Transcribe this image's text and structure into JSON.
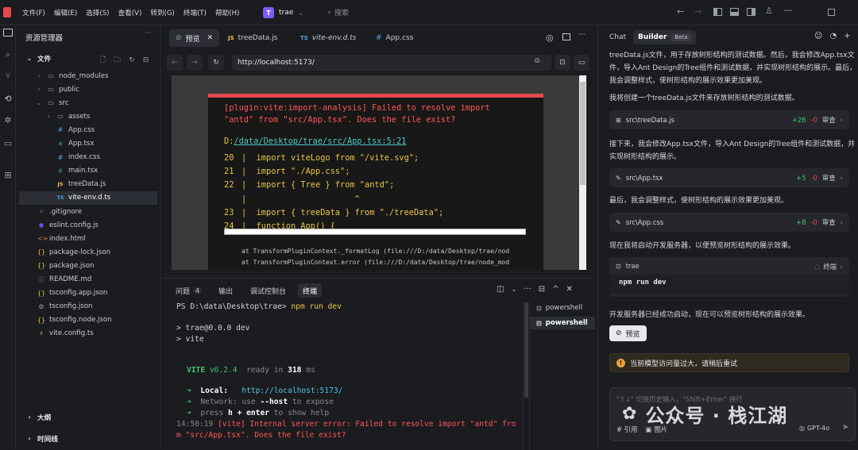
{
  "titlebar": {
    "menus": [
      "文件(F)",
      "编辑(E)",
      "选择(S)",
      "查看(V)",
      "转到(G)",
      "终端(T)",
      "帮助(H)"
    ],
    "project_initial": "T",
    "project_name": "trae",
    "search_placeholder": "搜索"
  },
  "explorer": {
    "title": "资源管理器",
    "files_header": "文件",
    "items": [
      {
        "label": "node_modules",
        "icon": "folder-icon"
      },
      {
        "label": "public",
        "icon": "folder-icon"
      },
      {
        "label": "src",
        "icon": "folder-open-icon"
      },
      {
        "label": "assets",
        "icon": "folder-icon"
      },
      {
        "label": "App.css",
        "icon": "css-icon"
      },
      {
        "label": "App.tsx",
        "icon": "react-icon"
      },
      {
        "label": "index.css",
        "icon": "css-icon"
      },
      {
        "label": "main.tsx",
        "icon": "react-icon"
      },
      {
        "label": "treeData.js",
        "icon": "js-icon"
      },
      {
        "label": "vite-env.d.ts",
        "icon": "ts-icon"
      },
      {
        "label": ".gitignore",
        "icon": "git-icon"
      },
      {
        "label": "eslint.config.js",
        "icon": "eslint-icon"
      },
      {
        "label": "index.html",
        "icon": "html-icon"
      },
      {
        "label": "package-lock.json",
        "icon": "json-icon"
      },
      {
        "label": "package.json",
        "icon": "json-icon"
      },
      {
        "label": "README.md",
        "icon": "info-icon"
      },
      {
        "label": "tsconfig.app.json",
        "icon": "json-icon"
      },
      {
        "label": "tsconfig.json",
        "icon": "gear-icon"
      },
      {
        "label": "tsconfig.node.json",
        "icon": "json-icon"
      },
      {
        "label": "vite.config.ts",
        "icon": "vite-icon"
      }
    ],
    "outline": "大纲",
    "timeline": "时间线"
  },
  "editor": {
    "tabs": [
      {
        "label": "预览",
        "icon": "compass-icon"
      },
      {
        "label": "treeData.js",
        "icon": "js-icon"
      },
      {
        "label": "vite-env.d.ts",
        "icon": "ts-icon"
      },
      {
        "label": "App.css",
        "icon": "css-icon"
      }
    ],
    "url": "http://localhost:5173/"
  },
  "error_overlay": {
    "message_line1": "[plugin:vite:import-analysis] Failed to resolve import",
    "message_line2": "\"antd\" from \"src/App.tsx\". Does the file exist?",
    "file_prefix": "D:",
    "file_path": "/data/Desktop/trae/src/App.tsx:5:21",
    "code": [
      {
        "no": "20",
        "code": "import viteLogo from \"/vite.svg\";"
      },
      {
        "no": "21",
        "code": "import \"./App.css\";"
      },
      {
        "no": "22",
        "code": "import { Tree } from \"antd\";"
      },
      {
        "no": "",
        "code": "                    ^"
      },
      {
        "no": "23",
        "code": "import { treeData } from \"./treeData\";"
      },
      {
        "no": "24",
        "code": "function App() {"
      }
    ],
    "stack1": "at TransformPluginContext._formatLog (file:///D:/data/Desktop/trae/nod",
    "stack2": "at TransformPluginContext.error (file:///D:/data/Desktop/trae/node_mod"
  },
  "terminal": {
    "tabs": [
      {
        "label": "问题",
        "badge": "4"
      },
      {
        "label": "输出"
      },
      {
        "label": "调试控制台"
      },
      {
        "label": "终端"
      }
    ],
    "ps_prompt": "PS D:\\data\\Desktop\\trae>",
    "ps_cmd": "npm run dev",
    "line_dev": "> trae@0.0.0 dev",
    "line_vite": "> vite",
    "vite_name": "VITE",
    "vite_version": "v6.2.4",
    "ready_text": "ready in",
    "ready_ms": "318",
    "ready_unit": "ms",
    "local_label": "Local:",
    "local_url": "http://localhost:5173/",
    "network_label": "Network:",
    "network_text": "use",
    "network_flag": "--host",
    "network_tail": "to expose",
    "help_pre": "press",
    "help_key": "h + enter",
    "help_post": "to show help",
    "err_time": "14:50:19",
    "err_text": "[vite] Internal server error: Failed to resolve import \"antd\" fro",
    "err_text2": "m \"src/App.tsx\". Does the file exist?",
    "shells": [
      "powershell",
      "powershell"
    ]
  },
  "chat": {
    "tabs": [
      "Chat",
      "Builder"
    ],
    "beta": "Beta",
    "intro": "treeData.js文件，用于存放树形结构的测试数据。然后，我会修改App.tsx文件，导入Ant Design的Tree组件和测试数据，并实现树形结构的展示。最后，我会调整样式，使树形结构的展示效果更加美观。",
    "step1": "我将创建一个treeData.js文件来存放树形结构的测试数据。",
    "file1": {
      "name": "src\\treeData.js",
      "add": "+26",
      "del": "-0",
      "review": "审查"
    },
    "step2": "接下来，我会修改App.tsx文件，导入Ant Design的Tree组件和测试数据，并实现树形结构的展示。",
    "file2": {
      "name": "src\\App.tsx",
      "add": "+5",
      "del": "-0",
      "review": "审查"
    },
    "step3": "最后，我会调整样式，使树形结构的展示效果更加美观。",
    "file3": {
      "name": "src\\App.css",
      "add": "+8",
      "del": "-0",
      "review": "审查"
    },
    "step4": "现在我将启动开发服务器，以便预览树形结构的展示效果。",
    "cmd_card": {
      "name": "trae",
      "status": "终端",
      "command": "npm run dev"
    },
    "step5": "开发服务器已经成功启动，现在可以预览树形结构的展示效果。",
    "preview_button": "预览",
    "warning": "当前模型访问量过大，请稍后重试",
    "input_placeholder": "\"↑↓\" 切换历史输入，\"Shift+Enter\" 换行",
    "ref_label": "# 引用",
    "image_label": "图片",
    "model": "GPT-4o",
    "watermark": "公众号 · 栈江湖"
  },
  "colors": {
    "accent": "#7c5cff",
    "error": "#e5484d",
    "success": "#46c46a",
    "warning": "#e8a33d",
    "link": "#4fa3e0"
  }
}
